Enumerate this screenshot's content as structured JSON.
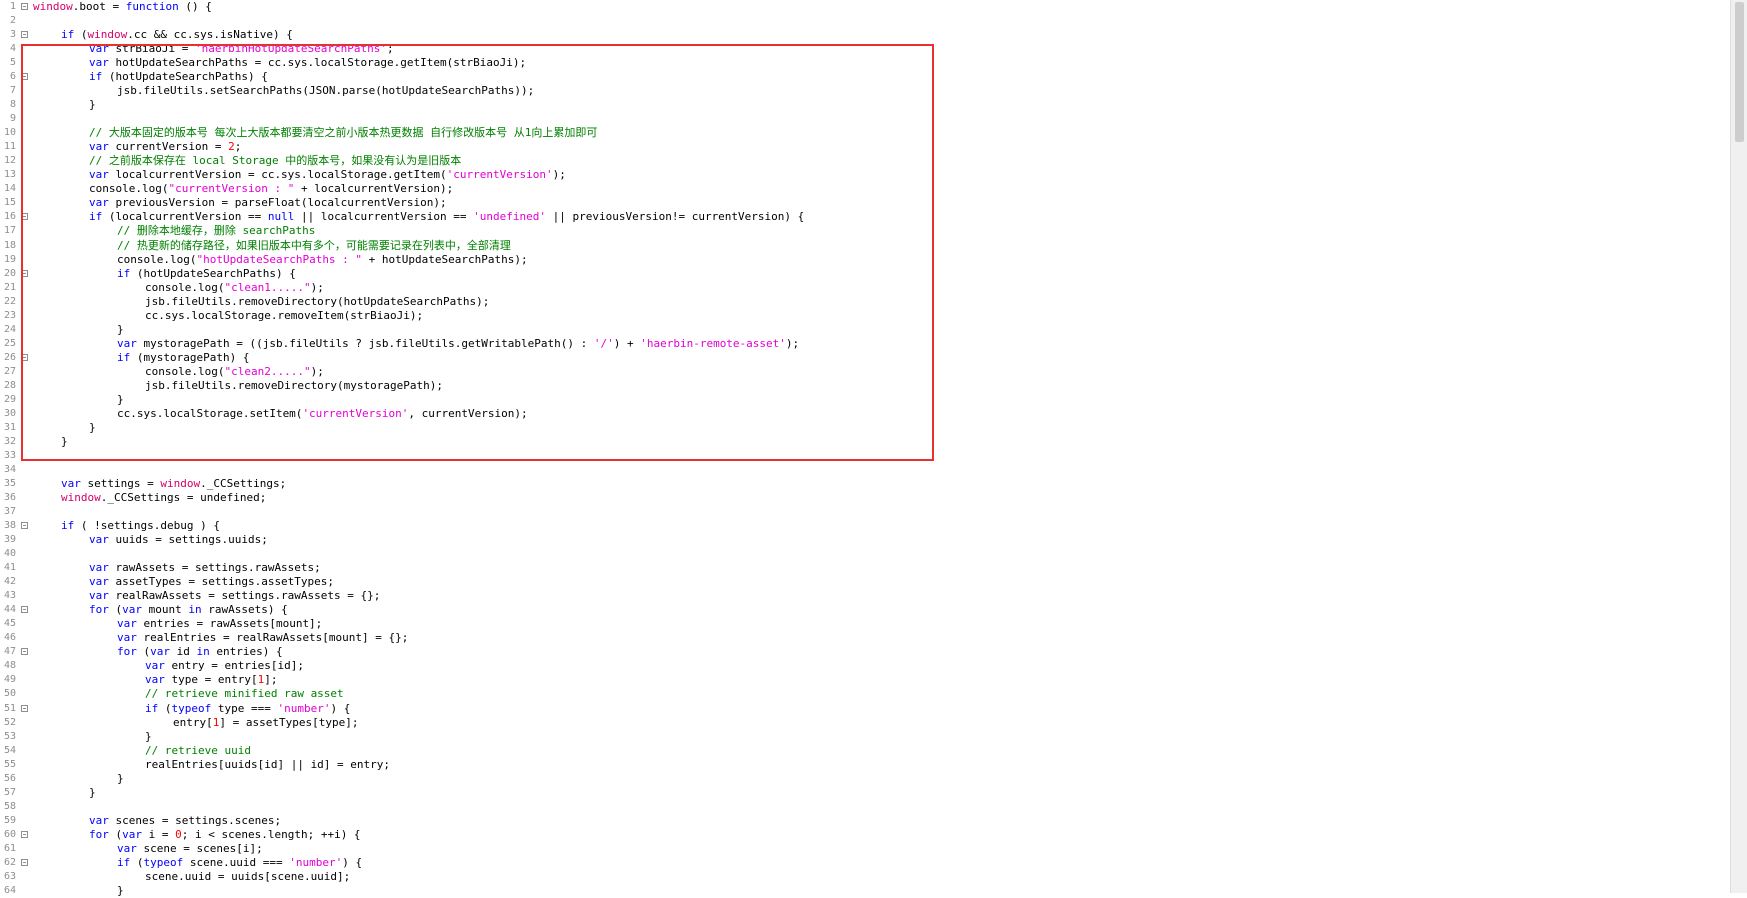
{
  "editor": {
    "lines": [
      {
        "n": "1",
        "fold": true,
        "indent": 0,
        "tokens": [
          [
            "win",
            "window"
          ],
          [
            "",
            "."
          ],
          [
            "",
            "boot"
          ],
          [
            "",
            " = "
          ],
          [
            "kw",
            "function"
          ],
          [
            "",
            " () {"
          ]
        ]
      },
      {
        "n": "2",
        "fold": false,
        "indent": 0,
        "tokens": []
      },
      {
        "n": "3",
        "fold": true,
        "indent": 1,
        "tokens": [
          [
            "kw",
            "if"
          ],
          [
            "",
            " ("
          ],
          [
            "win",
            "window"
          ],
          [
            "",
            ".cc && cc.sys.isNative) {"
          ]
        ]
      },
      {
        "n": "4",
        "fold": false,
        "indent": 2,
        "tokens": [
          [
            "kw",
            "var"
          ],
          [
            "",
            " strBiaoJi = "
          ],
          [
            "str",
            "'haerbinHotUpdateSearchPaths'"
          ],
          [
            "",
            ";"
          ]
        ]
      },
      {
        "n": "5",
        "fold": false,
        "indent": 2,
        "tokens": [
          [
            "kw",
            "var"
          ],
          [
            "",
            " hotUpdateSearchPaths = cc.sys.localStorage.getItem(strBiaoJi);"
          ]
        ]
      },
      {
        "n": "6",
        "fold": true,
        "indent": 2,
        "tokens": [
          [
            "kw",
            "if"
          ],
          [
            "",
            " (hotUpdateSearchPaths) {"
          ]
        ]
      },
      {
        "n": "7",
        "fold": false,
        "indent": 3,
        "tokens": [
          [
            "",
            "jsb.fileUtils.setSearchPaths(JSON.parse(hotUpdateSearchPaths));"
          ]
        ]
      },
      {
        "n": "8",
        "fold": false,
        "indent": 2,
        "tokens": [
          [
            "",
            "}"
          ]
        ]
      },
      {
        "n": "9",
        "fold": false,
        "indent": 0,
        "tokens": []
      },
      {
        "n": "10",
        "fold": false,
        "indent": 2,
        "tokens": [
          [
            "cm",
            "// 大版本固定的版本号 每次上大版本都要清空之前小版本热更数据 自行修改版本号 从1向上累加即可"
          ]
        ]
      },
      {
        "n": "11",
        "fold": false,
        "indent": 2,
        "tokens": [
          [
            "kw",
            "var"
          ],
          [
            "",
            " currentVersion = "
          ],
          [
            "num",
            "2"
          ],
          [
            "",
            ";"
          ]
        ]
      },
      {
        "n": "12",
        "fold": false,
        "indent": 2,
        "tokens": [
          [
            "cm",
            "// 之前版本保存在 local Storage 中的版本号，如果没有认为是旧版本"
          ]
        ]
      },
      {
        "n": "13",
        "fold": false,
        "indent": 2,
        "tokens": [
          [
            "kw",
            "var"
          ],
          [
            "",
            " localcurrentVersion = cc.sys.localStorage.getItem("
          ],
          [
            "str",
            "'currentVersion'"
          ],
          [
            "",
            ");"
          ]
        ]
      },
      {
        "n": "14",
        "fold": false,
        "indent": 2,
        "tokens": [
          [
            "",
            "console.log("
          ],
          [
            "str",
            "\"currentVersion : \""
          ],
          [
            "",
            " + localcurrentVersion);"
          ]
        ]
      },
      {
        "n": "15",
        "fold": false,
        "indent": 2,
        "tokens": [
          [
            "kw",
            "var"
          ],
          [
            "",
            " previousVersion = parseFloat(localcurrentVersion);"
          ]
        ]
      },
      {
        "n": "16",
        "fold": true,
        "indent": 2,
        "tokens": [
          [
            "kw",
            "if"
          ],
          [
            "",
            " (localcurrentVersion == "
          ],
          [
            "kw",
            "null"
          ],
          [
            "",
            " || localcurrentVersion == "
          ],
          [
            "str",
            "'undefined'"
          ],
          [
            "",
            " || previousVersion!= currentVersion) {"
          ]
        ]
      },
      {
        "n": "17",
        "fold": false,
        "indent": 3,
        "tokens": [
          [
            "cm",
            "// 删除本地缓存，删除 searchPaths"
          ]
        ]
      },
      {
        "n": "18",
        "fold": false,
        "indent": 3,
        "tokens": [
          [
            "cm",
            "// 热更新的储存路径，如果旧版本中有多个，可能需要记录在列表中，全部清理"
          ]
        ]
      },
      {
        "n": "19",
        "fold": false,
        "indent": 3,
        "tokens": [
          [
            "",
            "console.log("
          ],
          [
            "str",
            "\"hotUpdateSearchPaths : \""
          ],
          [
            "",
            " + hotUpdateSearchPaths);"
          ]
        ]
      },
      {
        "n": "20",
        "fold": true,
        "indent": 3,
        "tokens": [
          [
            "kw",
            "if"
          ],
          [
            "",
            " (hotUpdateSearchPaths) {"
          ]
        ]
      },
      {
        "n": "21",
        "fold": false,
        "indent": 4,
        "tokens": [
          [
            "",
            "console.log("
          ],
          [
            "str",
            "\"clean1.....\""
          ],
          [
            "",
            ");"
          ]
        ]
      },
      {
        "n": "22",
        "fold": false,
        "indent": 4,
        "tokens": [
          [
            "",
            "jsb.fileUtils.removeDirectory(hotUpdateSearchPaths);"
          ]
        ]
      },
      {
        "n": "23",
        "fold": false,
        "indent": 4,
        "tokens": [
          [
            "",
            "cc.sys.localStorage.removeItem(strBiaoJi);"
          ]
        ]
      },
      {
        "n": "24",
        "fold": false,
        "indent": 3,
        "tokens": [
          [
            "",
            "}"
          ]
        ]
      },
      {
        "n": "25",
        "fold": false,
        "indent": 3,
        "tokens": [
          [
            "kw",
            "var"
          ],
          [
            "",
            " mystoragePath = ((jsb.fileUtils ? jsb.fileUtils.getWritablePath() : "
          ],
          [
            "str",
            "'/'"
          ],
          [
            "",
            ") + "
          ],
          [
            "str",
            "'haerbin-remote-asset'"
          ],
          [
            "",
            ");"
          ]
        ]
      },
      {
        "n": "26",
        "fold": true,
        "indent": 3,
        "tokens": [
          [
            "kw",
            "if"
          ],
          [
            "",
            " (mystoragePath) {"
          ]
        ]
      },
      {
        "n": "27",
        "fold": false,
        "indent": 4,
        "tokens": [
          [
            "",
            "console.log("
          ],
          [
            "str",
            "\"clean2.....\""
          ],
          [
            "",
            ");"
          ]
        ]
      },
      {
        "n": "28",
        "fold": false,
        "indent": 4,
        "tokens": [
          [
            "",
            "jsb.fileUtils.removeDirectory(mystoragePath);"
          ]
        ]
      },
      {
        "n": "29",
        "fold": false,
        "indent": 3,
        "tokens": [
          [
            "",
            "}"
          ]
        ]
      },
      {
        "n": "30",
        "fold": false,
        "indent": 3,
        "tokens": [
          [
            "",
            "cc.sys.localStorage.setItem("
          ],
          [
            "str",
            "'currentVersion'"
          ],
          [
            "",
            ", currentVersion);"
          ]
        ]
      },
      {
        "n": "31",
        "fold": false,
        "indent": 2,
        "tokens": [
          [
            "",
            "}"
          ]
        ]
      },
      {
        "n": "32",
        "fold": false,
        "indent": 1,
        "tokens": [
          [
            "",
            "}"
          ]
        ]
      },
      {
        "n": "33",
        "fold": false,
        "indent": 0,
        "tokens": []
      },
      {
        "n": "34",
        "fold": false,
        "indent": 0,
        "tokens": []
      },
      {
        "n": "35",
        "fold": false,
        "indent": 1,
        "tokens": [
          [
            "kw",
            "var"
          ],
          [
            "",
            " settings = "
          ],
          [
            "win",
            "window"
          ],
          [
            "",
            "._CCSettings;"
          ]
        ]
      },
      {
        "n": "36",
        "fold": false,
        "indent": 1,
        "tokens": [
          [
            "win",
            "window"
          ],
          [
            "",
            "._CCSettings = undefined;"
          ]
        ]
      },
      {
        "n": "37",
        "fold": false,
        "indent": 0,
        "tokens": []
      },
      {
        "n": "38",
        "fold": true,
        "indent": 1,
        "tokens": [
          [
            "kw",
            "if"
          ],
          [
            "",
            " ( !settings.debug ) {"
          ]
        ]
      },
      {
        "n": "39",
        "fold": false,
        "indent": 2,
        "tokens": [
          [
            "kw",
            "var"
          ],
          [
            "",
            " uuids = settings.uuids;"
          ]
        ]
      },
      {
        "n": "40",
        "fold": false,
        "indent": 0,
        "tokens": []
      },
      {
        "n": "41",
        "fold": false,
        "indent": 2,
        "tokens": [
          [
            "kw",
            "var"
          ],
          [
            "",
            " rawAssets = settings.rawAssets;"
          ]
        ]
      },
      {
        "n": "42",
        "fold": false,
        "indent": 2,
        "tokens": [
          [
            "kw",
            "var"
          ],
          [
            "",
            " assetTypes = settings.assetTypes;"
          ]
        ]
      },
      {
        "n": "43",
        "fold": false,
        "indent": 2,
        "tokens": [
          [
            "kw",
            "var"
          ],
          [
            "",
            " realRawAssets = settings.rawAssets = {};"
          ]
        ]
      },
      {
        "n": "44",
        "fold": true,
        "indent": 2,
        "tokens": [
          [
            "kw",
            "for"
          ],
          [
            "",
            " ("
          ],
          [
            "kw",
            "var"
          ],
          [
            "",
            " mount "
          ],
          [
            "kw",
            "in"
          ],
          [
            "",
            " rawAssets) {"
          ]
        ]
      },
      {
        "n": "45",
        "fold": false,
        "indent": 3,
        "tokens": [
          [
            "kw",
            "var"
          ],
          [
            "",
            " entries = rawAssets[mount];"
          ]
        ]
      },
      {
        "n": "46",
        "fold": false,
        "indent": 3,
        "tokens": [
          [
            "kw",
            "var"
          ],
          [
            "",
            " realEntries = realRawAssets[mount] = {};"
          ]
        ]
      },
      {
        "n": "47",
        "fold": true,
        "indent": 3,
        "tokens": [
          [
            "kw",
            "for"
          ],
          [
            "",
            " ("
          ],
          [
            "kw",
            "var"
          ],
          [
            "",
            " id "
          ],
          [
            "kw",
            "in"
          ],
          [
            "",
            " entries) {"
          ]
        ]
      },
      {
        "n": "48",
        "fold": false,
        "indent": 4,
        "tokens": [
          [
            "kw",
            "var"
          ],
          [
            "",
            " entry = entries[id];"
          ]
        ]
      },
      {
        "n": "49",
        "fold": false,
        "indent": 4,
        "tokens": [
          [
            "kw",
            "var"
          ],
          [
            "",
            " type = entry["
          ],
          [
            "num",
            "1"
          ],
          [
            "",
            "];"
          ]
        ]
      },
      {
        "n": "50",
        "fold": false,
        "indent": 4,
        "tokens": [
          [
            "cm",
            "// retrieve minified raw asset"
          ]
        ]
      },
      {
        "n": "51",
        "fold": true,
        "indent": 4,
        "tokens": [
          [
            "kw",
            "if"
          ],
          [
            "",
            " ("
          ],
          [
            "kw",
            "typeof"
          ],
          [
            "",
            " type === "
          ],
          [
            "str",
            "'number'"
          ],
          [
            "",
            ") {"
          ]
        ]
      },
      {
        "n": "52",
        "fold": false,
        "indent": 5,
        "tokens": [
          [
            "",
            "entry["
          ],
          [
            "num",
            "1"
          ],
          [
            "",
            "] = assetTypes[type];"
          ]
        ]
      },
      {
        "n": "53",
        "fold": false,
        "indent": 4,
        "tokens": [
          [
            "",
            "}"
          ]
        ]
      },
      {
        "n": "54",
        "fold": false,
        "indent": 4,
        "tokens": [
          [
            "cm",
            "// retrieve uuid"
          ]
        ]
      },
      {
        "n": "55",
        "fold": false,
        "indent": 4,
        "tokens": [
          [
            "",
            "realEntries[uuids[id] || id] = entry;"
          ]
        ]
      },
      {
        "n": "56",
        "fold": false,
        "indent": 3,
        "tokens": [
          [
            "",
            "}"
          ]
        ]
      },
      {
        "n": "57",
        "fold": false,
        "indent": 2,
        "tokens": [
          [
            "",
            "}"
          ]
        ]
      },
      {
        "n": "58",
        "fold": false,
        "indent": 0,
        "tokens": []
      },
      {
        "n": "59",
        "fold": false,
        "indent": 2,
        "tokens": [
          [
            "kw",
            "var"
          ],
          [
            "",
            " scenes = settings.scenes;"
          ]
        ]
      },
      {
        "n": "60",
        "fold": true,
        "indent": 2,
        "tokens": [
          [
            "kw",
            "for"
          ],
          [
            "",
            " ("
          ],
          [
            "kw",
            "var"
          ],
          [
            "",
            " i = "
          ],
          [
            "num",
            "0"
          ],
          [
            "",
            "; i < scenes.length; ++i) {"
          ]
        ]
      },
      {
        "n": "61",
        "fold": false,
        "indent": 3,
        "tokens": [
          [
            "kw",
            "var"
          ],
          [
            "",
            " scene = scenes[i];"
          ]
        ]
      },
      {
        "n": "62",
        "fold": true,
        "indent": 3,
        "tokens": [
          [
            "kw",
            "if"
          ],
          [
            "",
            " ("
          ],
          [
            "kw",
            "typeof"
          ],
          [
            "",
            " scene.uuid === "
          ],
          [
            "str",
            "'number'"
          ],
          [
            "",
            ") {"
          ]
        ]
      },
      {
        "n": "63",
        "fold": false,
        "indent": 4,
        "tokens": [
          [
            "",
            "scene.uuid = uuids[scene.uuid];"
          ]
        ]
      },
      {
        "n": "64",
        "fold": false,
        "indent": 3,
        "tokens": [
          [
            "",
            "}"
          ]
        ]
      }
    ]
  }
}
